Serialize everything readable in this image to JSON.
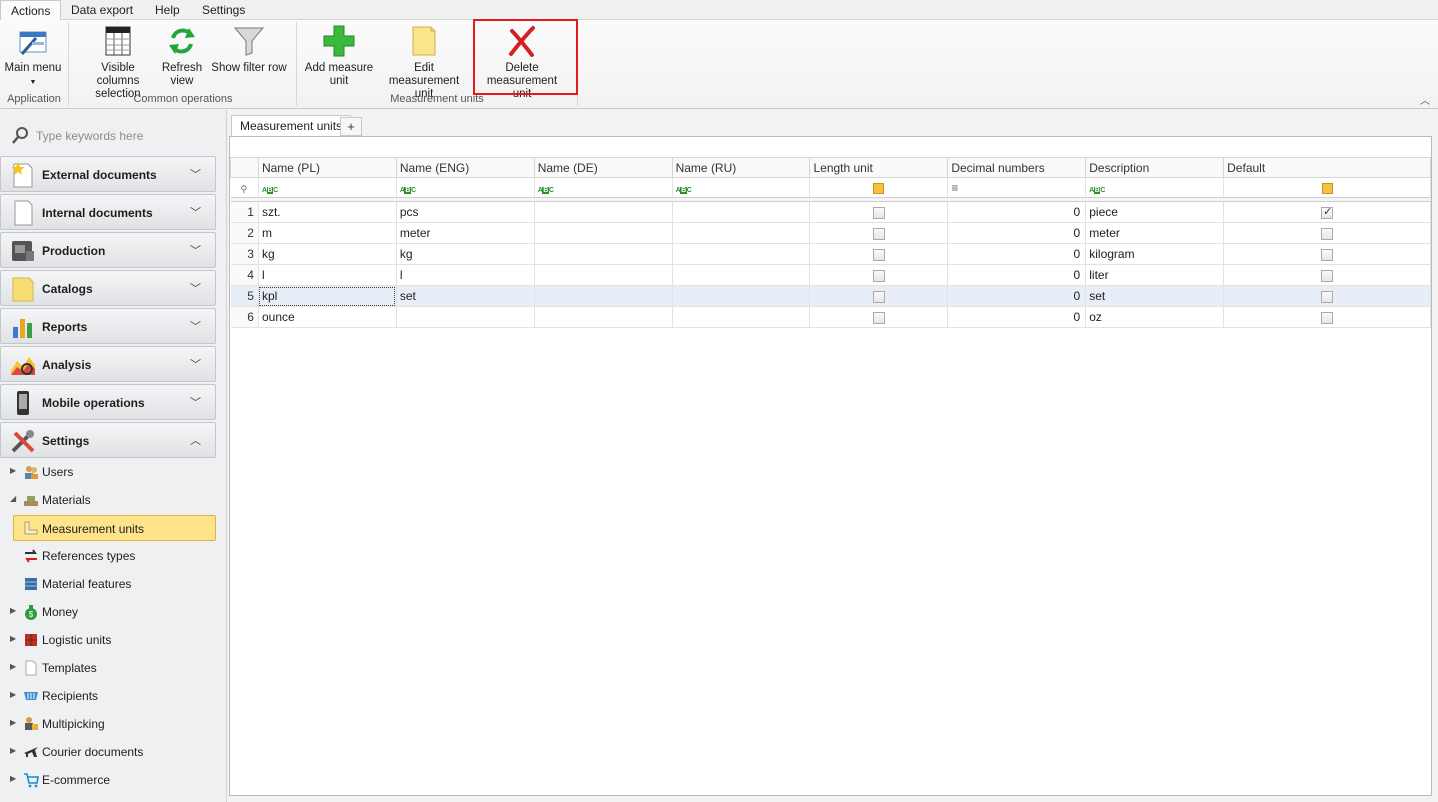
{
  "menu_tabs": [
    "Actions",
    "Data export",
    "Help",
    "Settings"
  ],
  "ribbon": {
    "buttons": {
      "main_menu": "Main menu",
      "visible_columns_1": "Visible columns",
      "visible_columns_2": "selection",
      "refresh_1": "Refresh",
      "refresh_2": "view",
      "show_filter_row": "Show filter row",
      "add_measure_1": "Add measure",
      "add_measure_2": "unit",
      "edit_measurement_1": "Edit measurement",
      "edit_measurement_2": "unit",
      "delete_measurement_1": "Delete",
      "delete_measurement_2": "measurement unit"
    },
    "groups": {
      "application": "Application",
      "common_operations": "Common operations",
      "measurement_units": "Measurement units"
    }
  },
  "sidebar": {
    "search_placeholder": "Type keywords here",
    "groups": [
      {
        "label": "External documents",
        "icon": "document-star-icon"
      },
      {
        "label": "Internal documents",
        "icon": "document-icon"
      },
      {
        "label": "Production",
        "icon": "machine-icon"
      },
      {
        "label": "Catalogs",
        "icon": "folder-icon"
      },
      {
        "label": "Reports",
        "icon": "bar-chart-icon"
      },
      {
        "label": "Analysis",
        "icon": "analysis-chart-icon"
      },
      {
        "label": "Mobile operations",
        "icon": "mobile-icon"
      },
      {
        "label": "Settings",
        "icon": "tools-icon"
      }
    ],
    "tree": [
      {
        "label": "Users",
        "icon": "users-icon"
      },
      {
        "label": "Materials",
        "icon": "materials-icon"
      },
      {
        "label": "Measurement units",
        "icon": "ruler-icon"
      },
      {
        "label": "References types",
        "icon": "exchange-icon"
      },
      {
        "label": "Material features",
        "icon": "features-icon"
      },
      {
        "label": "Money",
        "icon": "money-bag-icon"
      },
      {
        "label": "Logistic units",
        "icon": "boxes-icon"
      },
      {
        "label": "Templates",
        "icon": "template-icon"
      },
      {
        "label": "Recipients",
        "icon": "recipients-icon"
      },
      {
        "label": "Multipicking",
        "icon": "multipicking-icon"
      },
      {
        "label": "Courier documents",
        "icon": "plane-icon"
      },
      {
        "label": "E-commerce",
        "icon": "cart-icon"
      }
    ]
  },
  "content": {
    "tab_label": "Measurement units",
    "add_tab": "+",
    "columns": [
      "Name (PL)",
      "Name (ENG)",
      "Name (DE)",
      "Name (RU)",
      "Length unit",
      "Decimal numbers",
      "Description",
      "Default"
    ],
    "filter_icon": "≡",
    "rows": [
      {
        "n": "1",
        "pl": "szt.",
        "eng": "pcs",
        "de": "",
        "ru": "",
        "length": false,
        "dec": "0",
        "desc": "piece",
        "default": true
      },
      {
        "n": "2",
        "pl": "m",
        "eng": "meter",
        "de": "",
        "ru": "",
        "length": false,
        "dec": "0",
        "desc": "meter",
        "default": false
      },
      {
        "n": "3",
        "pl": "kg",
        "eng": "kg",
        "de": "",
        "ru": "",
        "length": false,
        "dec": "0",
        "desc": "kilogram",
        "default": false
      },
      {
        "n": "4",
        "pl": "l",
        "eng": "l",
        "de": "",
        "ru": "",
        "length": false,
        "dec": "0",
        "desc": "liter",
        "default": false
      },
      {
        "n": "5",
        "pl": "kpl",
        "eng": "set",
        "de": "",
        "ru": "",
        "length": false,
        "dec": "0",
        "desc": "set",
        "default": false
      },
      {
        "n": "6",
        "pl": "ounce",
        "eng": "",
        "de": "",
        "ru": "",
        "length": false,
        "dec": "0",
        "desc": "oz",
        "default": false
      }
    ]
  },
  "colors": {
    "highlight": "#e21b1b",
    "selected_item": "#fde38a",
    "row_highlight": "#e8eef7"
  }
}
